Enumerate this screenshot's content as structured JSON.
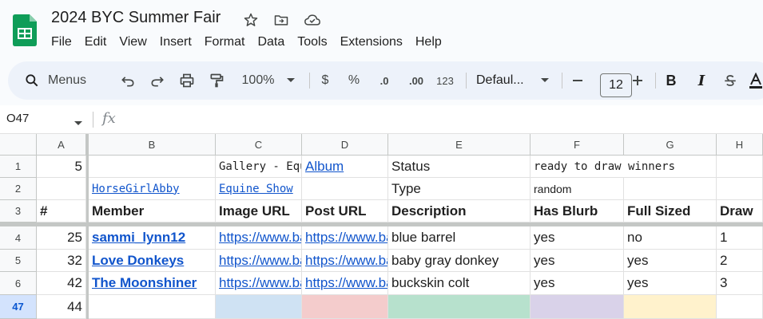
{
  "app": {
    "title": "2024 BYC Summer Fair",
    "menus": [
      "File",
      "Edit",
      "View",
      "Insert",
      "Format",
      "Data",
      "Tools",
      "Extensions",
      "Help"
    ]
  },
  "toolbar": {
    "search_label": "Menus",
    "zoom": "100%",
    "currency": "$",
    "percent": "%",
    "dec_decrease": ".0",
    "dec_increase": ".00",
    "number_format": "123",
    "font_name": "Defaul...",
    "font_size": "12"
  },
  "formula_bar": {
    "cell_ref": "O47",
    "fx": "fx"
  },
  "grid": {
    "columns": [
      "A",
      "B",
      "C",
      "D",
      "E",
      "F",
      "G",
      "H"
    ],
    "rows": [
      {
        "num": "1",
        "A": "5",
        "B": "",
        "C": "Gallery - Equine Show",
        "D": "Album",
        "E": "Status",
        "F": "ready to draw winners",
        "G": "",
        "H": ""
      },
      {
        "num": "2",
        "A": "",
        "B": "HorseGirlAbby",
        "C": "Equine Show",
        "D": "",
        "E": "Type",
        "F": "random",
        "G": "",
        "H": ""
      },
      {
        "num": "3",
        "A": "#",
        "B": "Member",
        "C": "Image URL",
        "D": "Post URL",
        "E": "Description",
        "F": "Has Blurb",
        "G": "Full Sized",
        "H": "Draw"
      },
      {
        "num": "4",
        "A": "25",
        "B": "sammi_lynn12",
        "C": "https://www.backyardchickens.com",
        "D": "https://www.backyardchickens.com",
        "E": "blue barrel",
        "F": "yes",
        "G": "no",
        "H": "1"
      },
      {
        "num": "5",
        "A": "32",
        "B": "Love Donkeys",
        "C": "https://www.backyardchickens.com",
        "D": "https://www.backyardchickens.com",
        "E": "baby gray donkey",
        "F": "yes",
        "G": "yes",
        "H": "2"
      },
      {
        "num": "6",
        "A": "42",
        "B": "The Moonshiner",
        "C": "https://www.backyardchickens.com",
        "D": "https://www.backyardchickens.com",
        "E": "buckskin colt",
        "F": "yes",
        "G": "yes",
        "H": "3"
      },
      {
        "num": "47",
        "A": "44",
        "B": "",
        "C": "",
        "D": "",
        "E": "",
        "F": "",
        "G": "",
        "H": ""
      }
    ]
  },
  "colors": {
    "accent": "#0b57d0",
    "link": "#1155cc",
    "sheets_green": "#0f9d58",
    "row47_c": "#cfe2f3",
    "row47_d": "#f4cccc",
    "row47_e": "#b7e1cd",
    "row47_f": "#d9d2e9",
    "row47_g": "#fff2cc"
  }
}
